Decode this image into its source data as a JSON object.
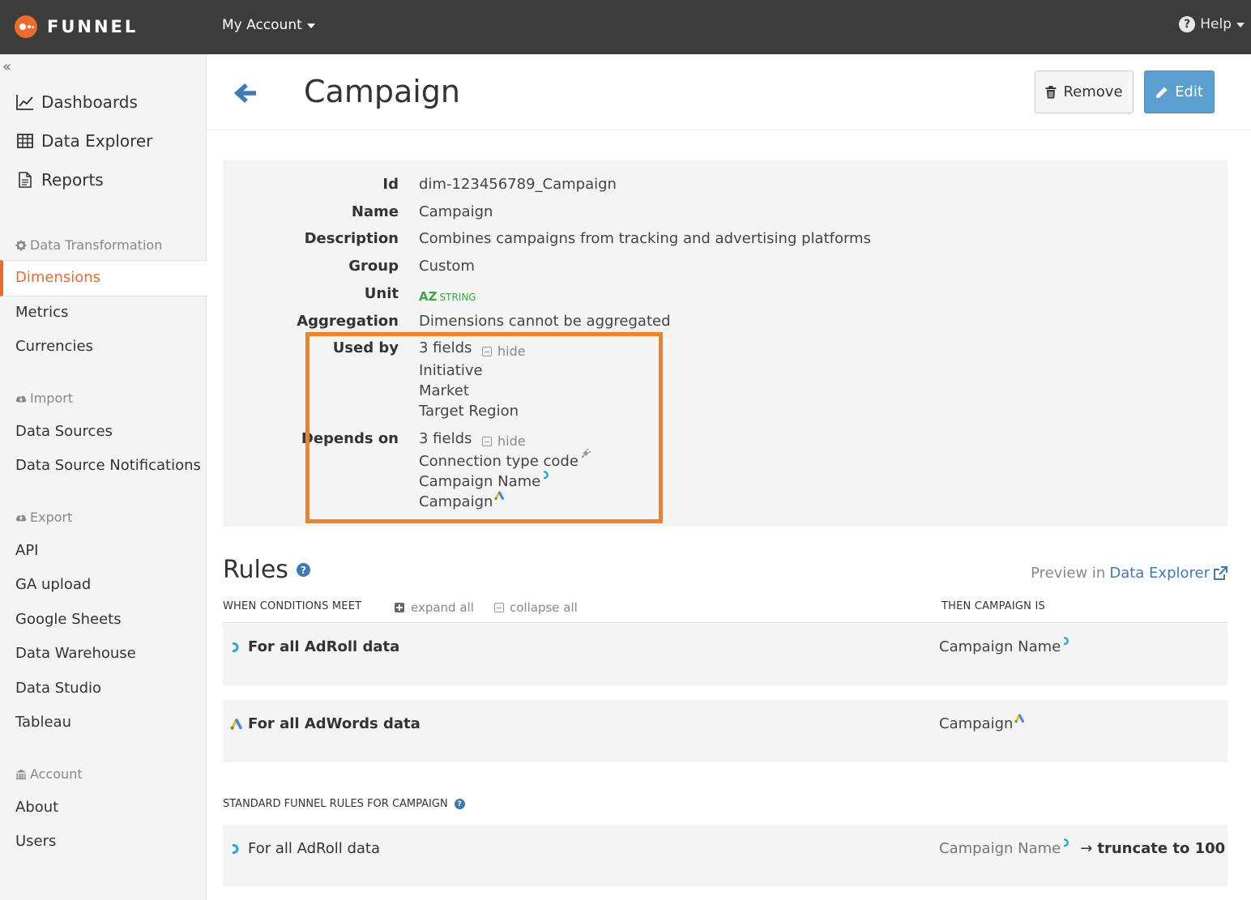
{
  "topbar": {
    "brand": "FUNNEL",
    "account_menu": "My Account",
    "help_menu": "Help"
  },
  "sidebar": {
    "collapse_glyph": "«",
    "main_nav": [
      {
        "label": "Dashboards",
        "icon": "line-chart-icon"
      },
      {
        "label": "Data Explorer",
        "icon": "table-icon"
      },
      {
        "label": "Reports",
        "icon": "document-icon"
      }
    ],
    "sections": {
      "transformation": {
        "title": "Data Transformation",
        "items": [
          "Dimensions",
          "Metrics",
          "Currencies"
        ]
      },
      "import": {
        "title": "Import",
        "items": [
          "Data Sources",
          "Data Source Notifications"
        ]
      },
      "export": {
        "title": "Export",
        "items": [
          "API",
          "GA upload",
          "Google Sheets",
          "Data Warehouse",
          "Data Studio",
          "Tableau"
        ]
      },
      "account": {
        "title": "Account",
        "items": [
          "About",
          "Users"
        ]
      }
    },
    "active_item": "Dimensions"
  },
  "header": {
    "title": "Campaign",
    "remove_label": "Remove",
    "edit_label": "Edit"
  },
  "details": {
    "labels": {
      "id": "Id",
      "name": "Name",
      "description": "Description",
      "group": "Group",
      "unit": "Unit",
      "aggregation": "Aggregation",
      "used_by": "Used by",
      "depends_on": "Depends on"
    },
    "id": "dim-123456789_Campaign",
    "name": "Campaign",
    "description": "Combines campaigns from tracking and advertising platforms",
    "group": "Custom",
    "unit_badge": "AZ",
    "unit_type": "STRING",
    "aggregation": "Dimensions cannot be aggregated",
    "used_by": {
      "count": "3 fields",
      "toggle": "hide",
      "fields": [
        "Initiative",
        "Market",
        "Target Region"
      ]
    },
    "depends_on": {
      "count": "3 fields",
      "toggle": "hide",
      "fields": [
        {
          "label": "Connection type code",
          "icon": "plug-icon"
        },
        {
          "label": "Campaign Name",
          "icon": "adroll-icon"
        },
        {
          "label": "Campaign",
          "icon": "adwords-icon"
        }
      ]
    }
  },
  "rules": {
    "title": "Rules",
    "preview_prefix": "Preview in",
    "preview_link": "Data Explorer",
    "col_conditions": "WHEN CONDITIONS MEET",
    "expand_all": "expand all",
    "collapse_all": "collapse all",
    "col_result": "THEN CAMPAIGN IS",
    "items": [
      {
        "condition": "For all AdRoll data",
        "result": "Campaign Name",
        "source_icon": "adroll-icon"
      },
      {
        "condition": "For all AdWords data",
        "result": "Campaign",
        "source_icon": "adwords-icon"
      }
    ],
    "standard_title": "STANDARD FUNNEL RULES FOR CAMPAIGN",
    "standard_items": [
      {
        "condition": "For all AdRoll data",
        "result": "Campaign Name",
        "arrow": "→",
        "operation": "truncate to 100",
        "source_icon": "adroll-icon"
      }
    ]
  },
  "colors": {
    "brand": "#ef6a2d",
    "link": "#3d7ab8",
    "edit_button": "#5a9fd0",
    "highlight": "#f58220",
    "unit_green": "#3aa845"
  }
}
